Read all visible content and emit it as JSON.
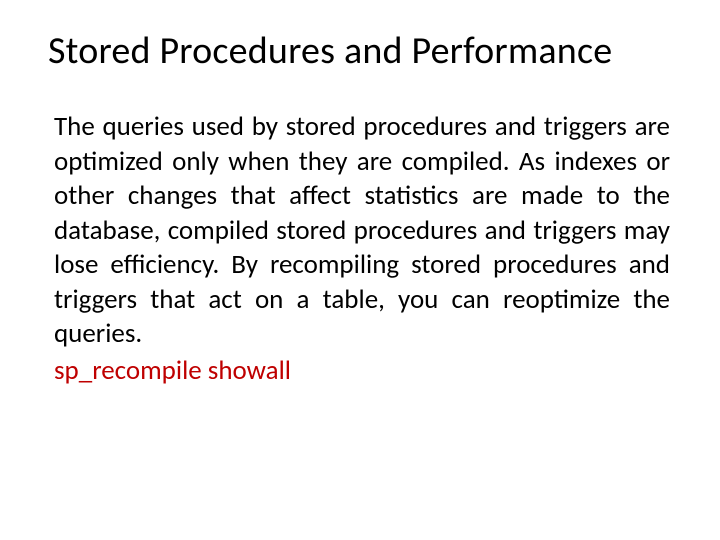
{
  "title": "Stored Procedures and Performance",
  "body": "The queries used by stored procedures and triggers are optimized only when they are compiled. As indexes or other changes that affect statistics are made to the database, compiled stored procedures and triggers may lose efficiency. By recompiling stored procedures and triggers that act on a table, you can reoptimize the queries.",
  "code": "sp_recompile showall"
}
